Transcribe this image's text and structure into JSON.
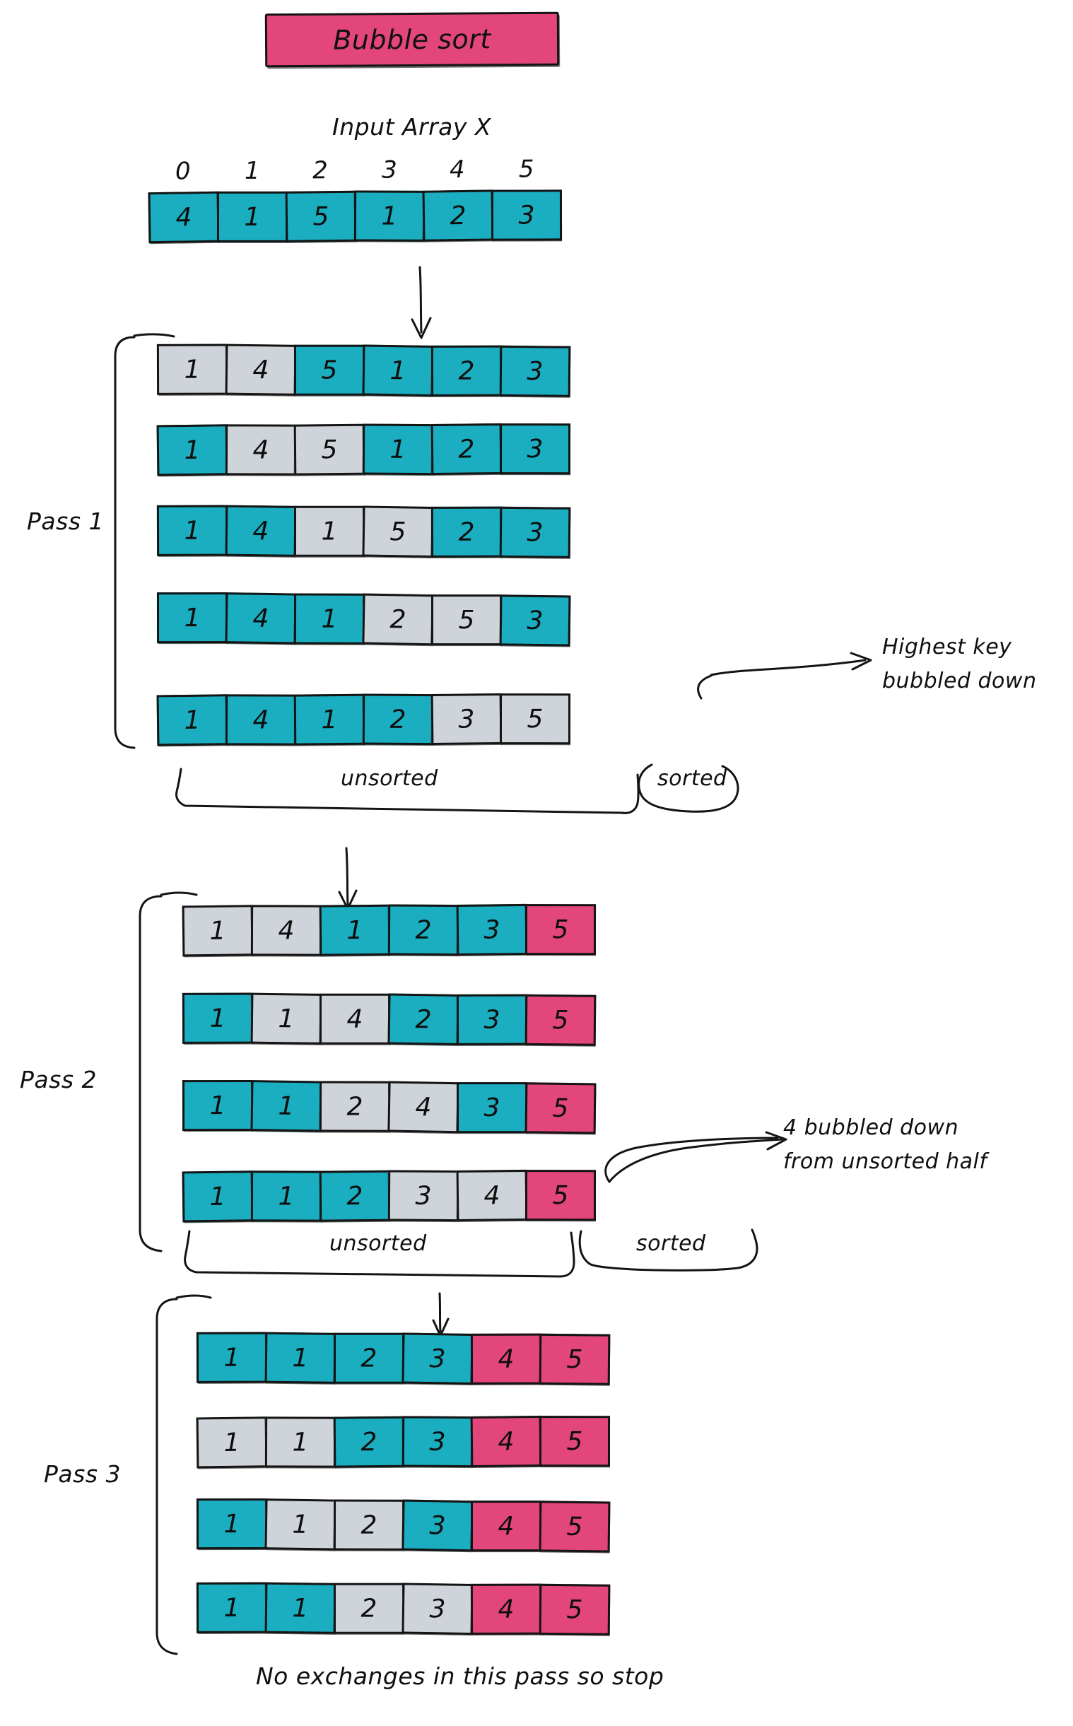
{
  "title": {
    "label": "Bubble sort",
    "box_color": "#E3467B"
  },
  "palette": {
    "teal": "#1AAEC0",
    "gray": "#CED4DA",
    "pink": "#E3467B",
    "ink": "#141414"
  },
  "input": {
    "caption": "Input Array X",
    "indices": [
      "0",
      "1",
      "2",
      "3",
      "4",
      "5"
    ],
    "values": [
      "4",
      "1",
      "5",
      "1",
      "2",
      "3"
    ],
    "colors": [
      "teal",
      "teal",
      "teal",
      "teal",
      "teal",
      "teal"
    ]
  },
  "passes": [
    {
      "label": "Pass 1",
      "rows": [
        {
          "values": [
            "1",
            "4",
            "5",
            "1",
            "2",
            "3"
          ],
          "colors": [
            "gray",
            "gray",
            "teal",
            "teal",
            "teal",
            "teal"
          ]
        },
        {
          "values": [
            "1",
            "4",
            "5",
            "1",
            "2",
            "3"
          ],
          "colors": [
            "teal",
            "gray",
            "gray",
            "teal",
            "teal",
            "teal"
          ]
        },
        {
          "values": [
            "1",
            "4",
            "1",
            "5",
            "2",
            "3"
          ],
          "colors": [
            "teal",
            "teal",
            "gray",
            "gray",
            "teal",
            "teal"
          ]
        },
        {
          "values": [
            "1",
            "4",
            "1",
            "2",
            "5",
            "3"
          ],
          "colors": [
            "teal",
            "teal",
            "teal",
            "gray",
            "gray",
            "teal"
          ]
        },
        {
          "values": [
            "1",
            "4",
            "1",
            "2",
            "3",
            "5"
          ],
          "colors": [
            "teal",
            "teal",
            "teal",
            "teal",
            "gray",
            "gray"
          ]
        }
      ],
      "annotation": "Highest key\nbubbled down",
      "annotation_line1": "Highest key",
      "annotation_line2": "bubbled down",
      "unsorted_label": "unsorted",
      "sorted_label": "sorted"
    },
    {
      "label": "Pass 2",
      "rows": [
        {
          "values": [
            "1",
            "4",
            "1",
            "2",
            "3",
            "5"
          ],
          "colors": [
            "gray",
            "gray",
            "teal",
            "teal",
            "teal",
            "pink"
          ]
        },
        {
          "values": [
            "1",
            "1",
            "4",
            "2",
            "3",
            "5"
          ],
          "colors": [
            "teal",
            "gray",
            "gray",
            "teal",
            "teal",
            "pink"
          ]
        },
        {
          "values": [
            "1",
            "1",
            "2",
            "4",
            "3",
            "5"
          ],
          "colors": [
            "teal",
            "teal",
            "gray",
            "gray",
            "teal",
            "pink"
          ]
        },
        {
          "values": [
            "1",
            "1",
            "2",
            "3",
            "4",
            "5"
          ],
          "colors": [
            "teal",
            "teal",
            "teal",
            "gray",
            "gray",
            "pink"
          ]
        }
      ],
      "annotation_line1": "4 bubbled down",
      "annotation_line2": "from unsorted half",
      "unsorted_label": "unsorted",
      "sorted_label": "sorted"
    },
    {
      "label": "Pass 3",
      "rows": [
        {
          "values": [
            "1",
            "1",
            "2",
            "3",
            "4",
            "5"
          ],
          "colors": [
            "teal",
            "teal",
            "teal",
            "teal",
            "pink",
            "pink"
          ]
        },
        {
          "values": [
            "1",
            "1",
            "2",
            "3",
            "4",
            "5"
          ],
          "colors": [
            "gray",
            "gray",
            "teal",
            "teal",
            "pink",
            "pink"
          ]
        },
        {
          "values": [
            "1",
            "1",
            "2",
            "3",
            "4",
            "5"
          ],
          "colors": [
            "teal",
            "gray",
            "gray",
            "teal",
            "pink",
            "pink"
          ]
        },
        {
          "values": [
            "1",
            "1",
            "2",
            "3",
            "4",
            "5"
          ],
          "colors": [
            "teal",
            "teal",
            "gray",
            "gray",
            "pink",
            "pink"
          ]
        }
      ]
    }
  ],
  "footer": {
    "label": "No exchanges in this pass so stop"
  }
}
